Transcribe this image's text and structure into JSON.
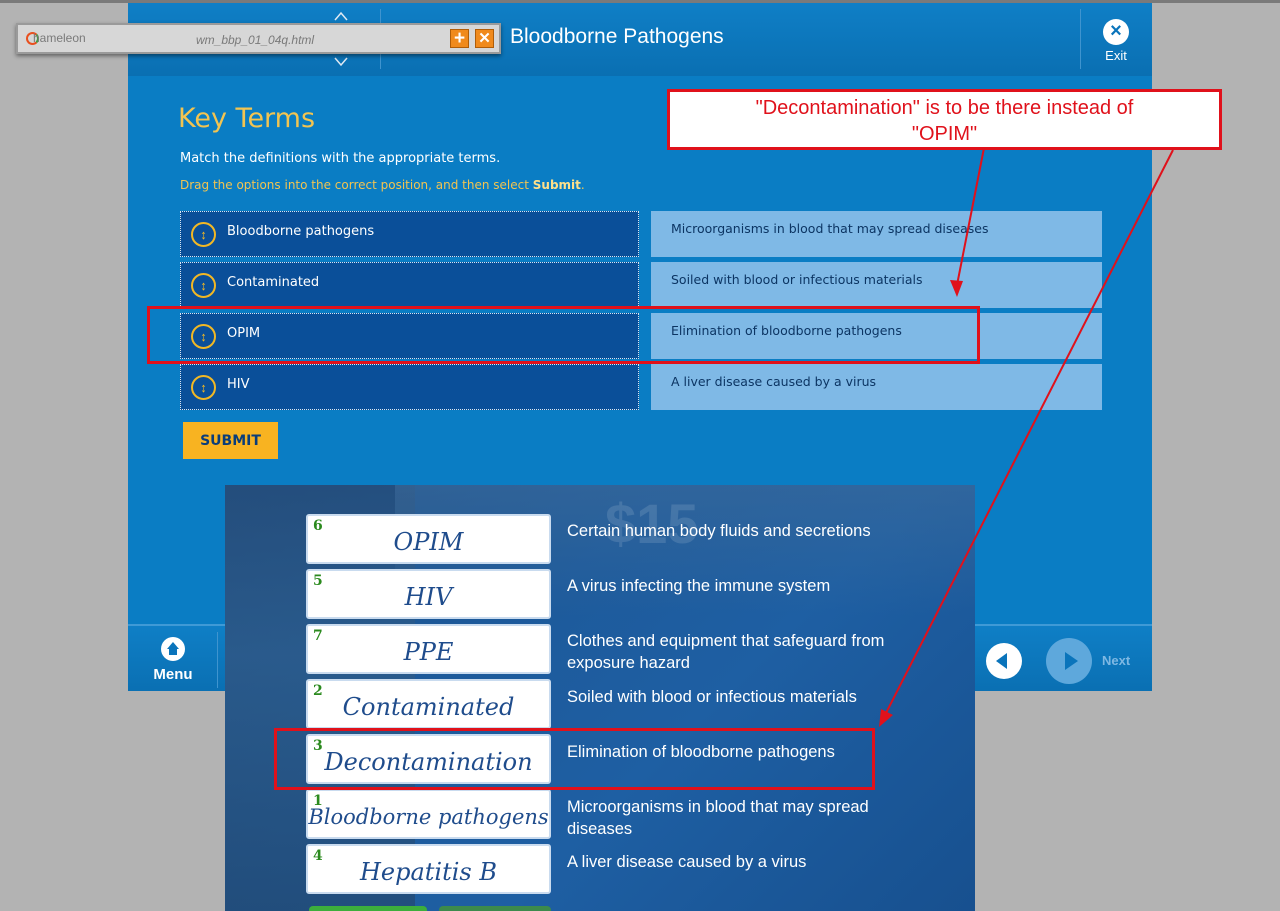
{
  "course": {
    "title": "Bloodborne Pathogens",
    "exit_label": "Exit",
    "heading": "Key Terms",
    "instruction": "Match the definitions with the appropriate terms.",
    "drag_instruction_prefix": "Drag the options into the correct position, and then select ",
    "drag_instruction_emph": "Submit",
    "drag_instruction_suffix": ".",
    "terms": [
      "Bloodborne pathogens",
      "Contaminated",
      "OPIM",
      "HIV"
    ],
    "definitions": [
      "Microorganisms in blood that may spread diseases",
      "Soiled with blood or infectious materials",
      "Elimination of bloodborne pathogens",
      "A liver disease caused by a virus"
    ],
    "submit_label": "SUBMIT",
    "footer": {
      "menu_label": "Menu",
      "next_label": "Next"
    }
  },
  "chameleon": {
    "logo": "hameleon",
    "filename": "wm_bbp_01_04q.html",
    "plus_glyph": "+",
    "close_glyph": "✕"
  },
  "overlay": {
    "rows": [
      {
        "num": "6",
        "term": "OPIM",
        "definition": "Certain human body fluids and secretions"
      },
      {
        "num": "5",
        "term": "HIV",
        "definition": "A virus infecting the immune system"
      },
      {
        "num": "7",
        "term": "PPE",
        "definition": "Clothes and equipment that safeguard from exposure hazard"
      },
      {
        "num": "2",
        "term": "Contaminated",
        "definition": "Soiled with blood or infectious materials"
      },
      {
        "num": "3",
        "term": "Decontamination",
        "definition": "Elimination of bloodborne pathogens"
      },
      {
        "num": "1",
        "term": "Bloodborne pathogens",
        "definition": "Microorganisms in blood that may spread diseases"
      },
      {
        "num": "4",
        "term": "Hepatitis B",
        "definition": "A liver disease caused by a virus"
      }
    ]
  },
  "annotation": {
    "callout_line1": "\"Decontamination\" is to be there instead of",
    "callout_line2": "\"OPIM\"",
    "color": "#e0111b"
  },
  "colors": {
    "course_blue": "#0a7dc4",
    "term_dark": "#0a4f99",
    "definition_light": "#7fb9e6",
    "accent_yellow": "#f2c451",
    "submit_orange": "#f8b321"
  }
}
